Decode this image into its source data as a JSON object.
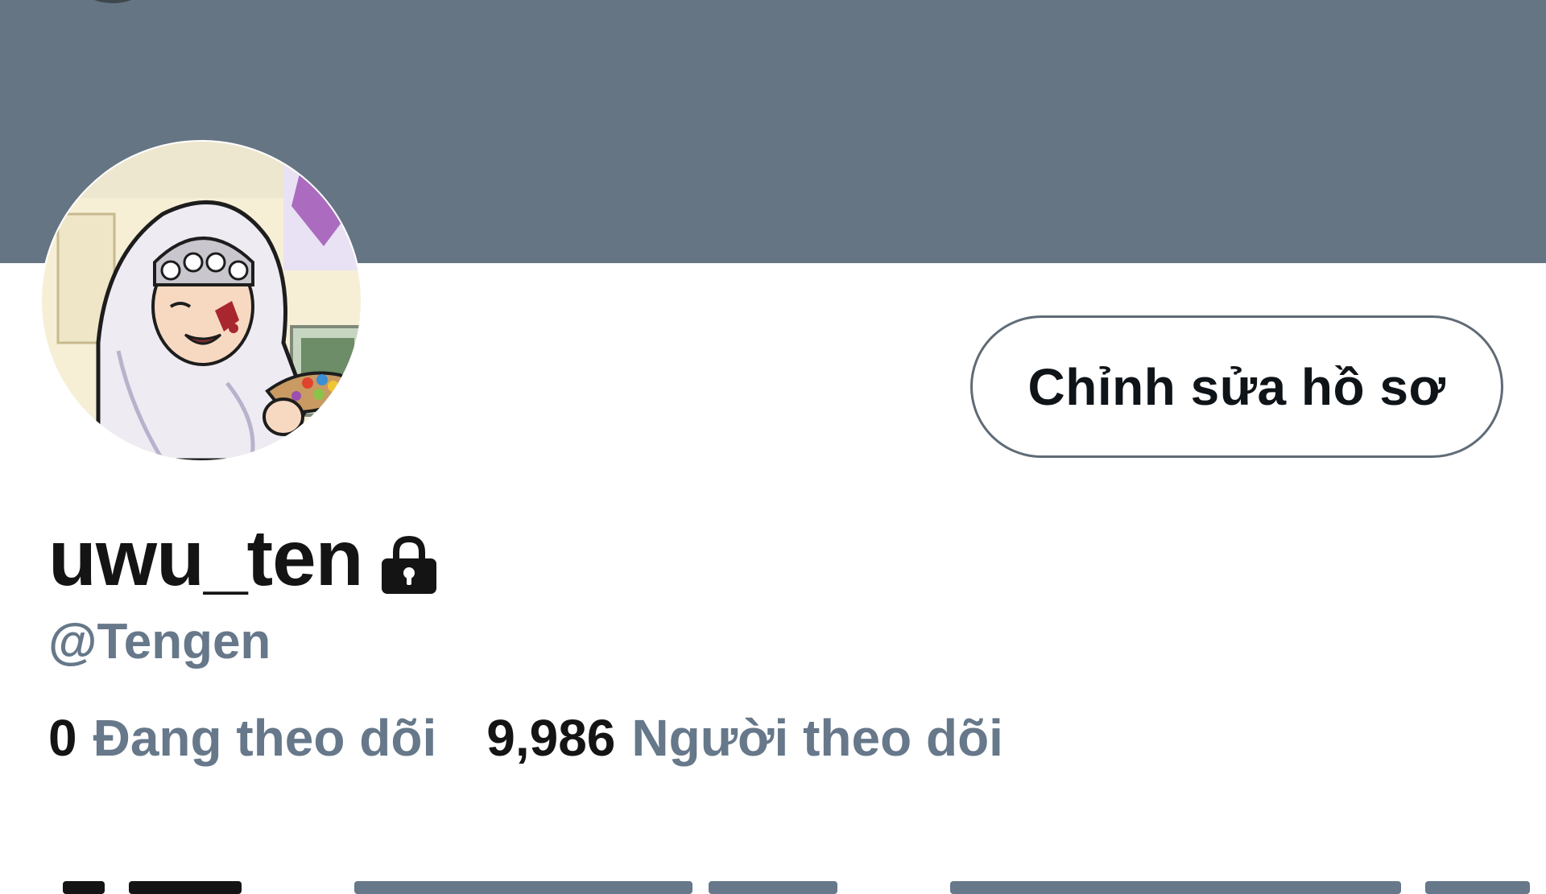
{
  "profile": {
    "display_name": "uwu_ten",
    "handle": "@Tengen",
    "edit_button_label": "Chỉnh sửa hồ sơ",
    "protected_icon": "lock-icon",
    "banner_color": "#667584"
  },
  "stats": {
    "following_count": "0",
    "following_label": "Đang theo dõi",
    "followers_count": "9,986",
    "followers_label": "Người theo dõi"
  },
  "colors": {
    "primary_text": "#141414",
    "secondary_text": "#66788a",
    "button_border": "#5f6b76"
  }
}
